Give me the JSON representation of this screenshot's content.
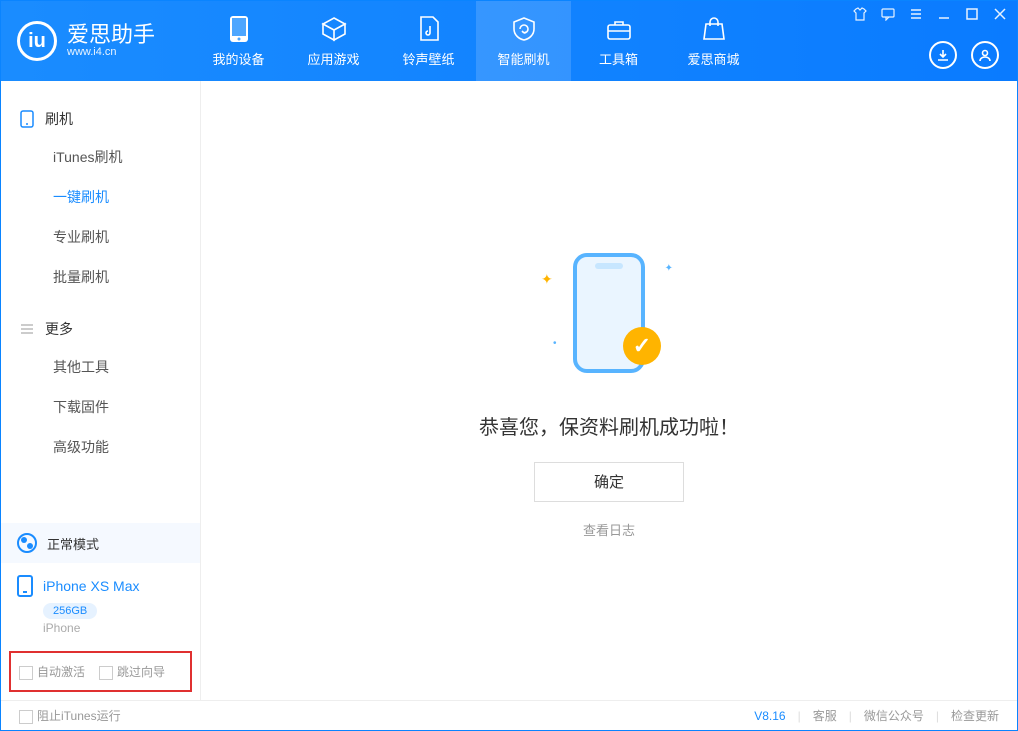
{
  "app": {
    "title": "爱思助手",
    "subtitle": "www.i4.cn"
  },
  "nav": {
    "items": [
      {
        "key": "device",
        "label": "我的设备"
      },
      {
        "key": "apps",
        "label": "应用游戏"
      },
      {
        "key": "ring",
        "label": "铃声壁纸"
      },
      {
        "key": "flash",
        "label": "智能刷机"
      },
      {
        "key": "toolbox",
        "label": "工具箱"
      },
      {
        "key": "store",
        "label": "爱思商城"
      }
    ]
  },
  "sidebar": {
    "section_flash": "刷机",
    "flash_items": {
      "itunes": "iTunes刷机",
      "onekey": "一键刷机",
      "pro": "专业刷机",
      "batch": "批量刷机"
    },
    "section_more": "更多",
    "more_items": {
      "other": "其他工具",
      "firmware": "下载固件",
      "advanced": "高级功能"
    }
  },
  "device": {
    "mode": "正常模式",
    "name": "iPhone XS Max",
    "storage": "256GB",
    "type": "iPhone"
  },
  "options": {
    "auto_activate": "自动激活",
    "skip_guide": "跳过向导"
  },
  "main": {
    "success_message": "恭喜您，保资料刷机成功啦！",
    "ok_button": "确定",
    "view_log": "查看日志"
  },
  "status": {
    "block_itunes": "阻止iTunes运行",
    "version": "V8.16",
    "service": "客服",
    "wechat": "微信公众号",
    "update": "检查更新"
  }
}
